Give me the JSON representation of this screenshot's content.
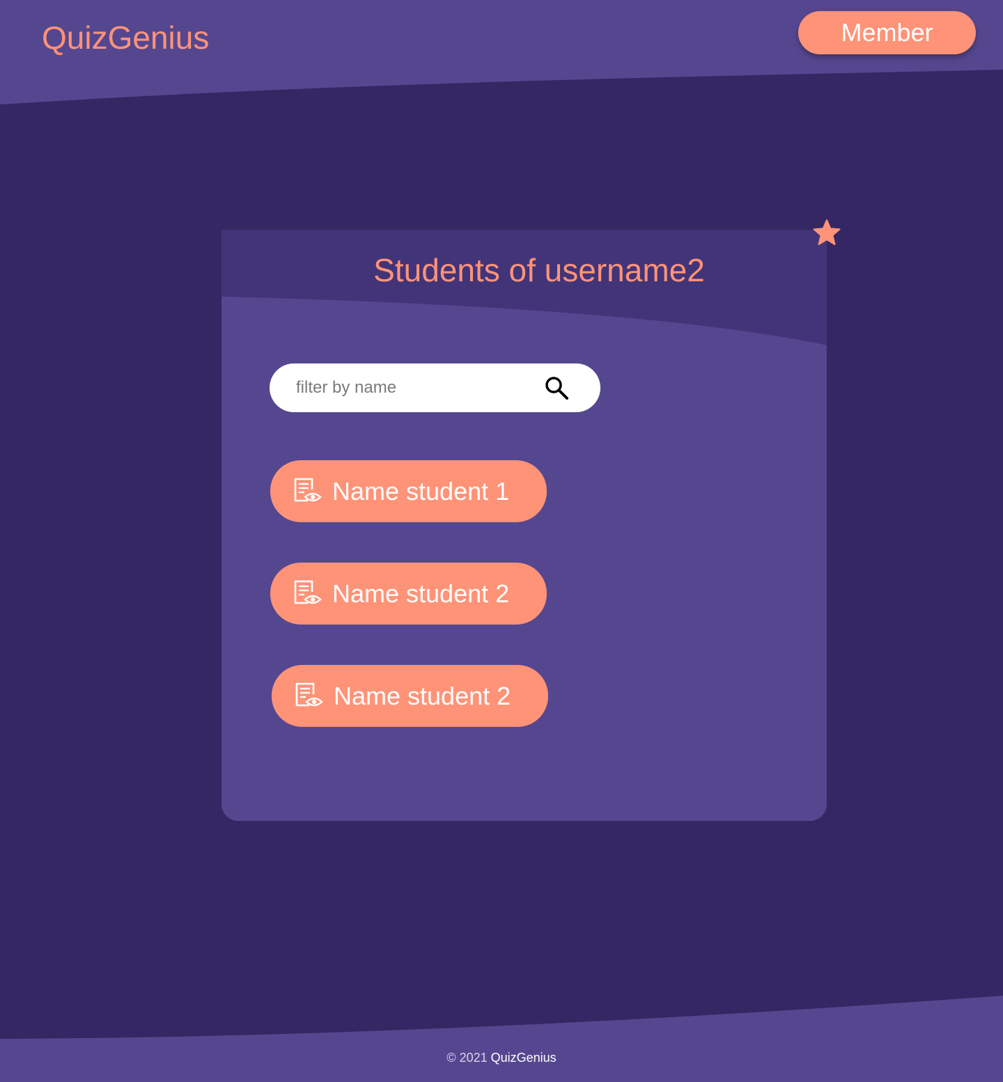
{
  "header": {
    "app_title": "QuizGenius",
    "member_label": "Member"
  },
  "card": {
    "title": "Students of username2",
    "search": {
      "placeholder": "filter by name",
      "value": ""
    },
    "students": [
      {
        "label": "Name student 1",
        "icon": "view-report-icon"
      },
      {
        "label": "Name student 2",
        "icon": "view-report-icon"
      },
      {
        "label": "Name student 2",
        "icon": "view-report-icon"
      }
    ],
    "badge_icon": "star-icon"
  },
  "footer": {
    "copyright": "© 2021",
    "brand": "QuizGenius"
  },
  "colors": {
    "page_background": "#352763",
    "header_background": "#55478F",
    "card_background": "#55478F",
    "card_header_background": "#423479",
    "accent": "#FF9378",
    "text_on_accent": "#FFFFFF"
  }
}
